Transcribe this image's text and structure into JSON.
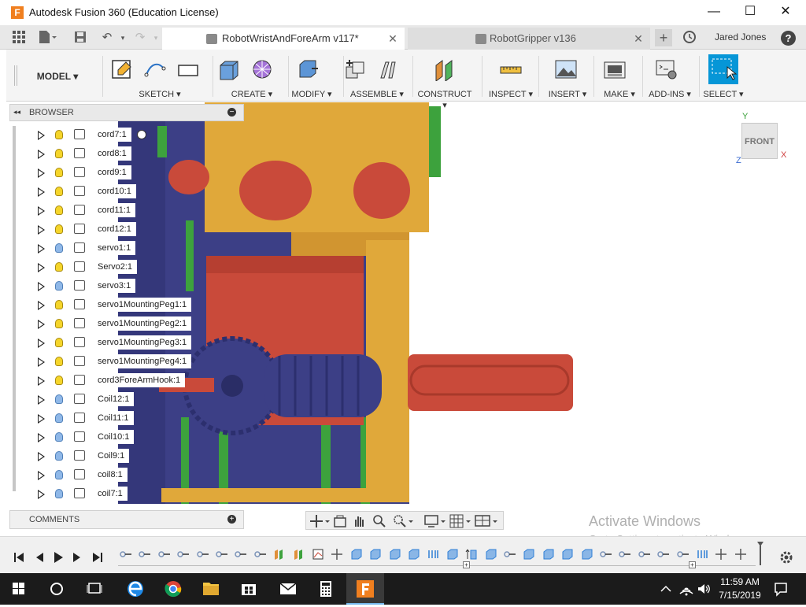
{
  "window": {
    "title": "Autodesk Fusion 360 (Education License)",
    "minimize_glyph": "—",
    "maximize_glyph": "☐",
    "close_glyph": "✕"
  },
  "tabs": [
    {
      "label": "RobotWristAndForeArm v117*",
      "active": true
    },
    {
      "label": "RobotGripper v136",
      "active": false
    }
  ],
  "tab_close_glyph": "✕",
  "new_tab_glyph": "+",
  "user": {
    "name": "Jared Jones"
  },
  "help_glyph": "?",
  "ribbon": {
    "workspace": "MODEL ▾",
    "groups": [
      {
        "label": "SKETCH ▾"
      },
      {
        "label": "CREATE ▾"
      },
      {
        "label": "MODIFY ▾"
      },
      {
        "label": "ASSEMBLE ▾"
      },
      {
        "label": "CONSTRUCT ▾"
      },
      {
        "label": "INSPECT ▾"
      },
      {
        "label": "INSERT ▾"
      },
      {
        "label": "MAKE ▾"
      },
      {
        "label": "ADD-INS ▾"
      },
      {
        "label": "SELECT ▾"
      }
    ]
  },
  "browser": {
    "title": "BROWSER",
    "collapse_glyph": "◂◂",
    "items": [
      {
        "label": "cord7:1",
        "bulb": "on"
      },
      {
        "label": "cord8:1",
        "bulb": "on"
      },
      {
        "label": "cord9:1",
        "bulb": "on"
      },
      {
        "label": "cord10:1",
        "bulb": "on"
      },
      {
        "label": "cord11:1",
        "bulb": "on"
      },
      {
        "label": "cord12:1",
        "bulb": "on"
      },
      {
        "label": "servo1:1",
        "bulb": "off"
      },
      {
        "label": "Servo2:1",
        "bulb": "on"
      },
      {
        "label": "servo3:1",
        "bulb": "off"
      },
      {
        "label": "servo1MountingPeg1:1",
        "bulb": "on"
      },
      {
        "label": "servo1MountingPeg2:1",
        "bulb": "on"
      },
      {
        "label": "servo1MountingPeg3:1",
        "bulb": "on"
      },
      {
        "label": "servo1MountingPeg4:1",
        "bulb": "on"
      },
      {
        "label": "cord3ForeArmHook:1",
        "bulb": "on"
      },
      {
        "label": "Coil12:1",
        "bulb": "off"
      },
      {
        "label": "Coil11:1",
        "bulb": "off"
      },
      {
        "label": "Coil10:1",
        "bulb": "off"
      },
      {
        "label": "Coil9:1",
        "bulb": "off"
      },
      {
        "label": "coil8:1",
        "bulb": "off"
      },
      {
        "label": "coil7:1",
        "bulb": "off"
      }
    ]
  },
  "comments": {
    "title": "COMMENTS",
    "add_glyph": "+"
  },
  "viewcube": {
    "face": "FRONT",
    "axis_y": "Y",
    "axis_x": "X",
    "axis_z": "Z"
  },
  "watermark": {
    "line1": "Activate Windows",
    "line2": "Go to Settings to activate Windows."
  },
  "clock": {
    "time": "11:59 AM",
    "date": "7/15/2019"
  },
  "colors": {
    "accent": "#0696d7",
    "bulb_on": "#f5d52a",
    "bulb_off": "#8fb8e8",
    "model_yellow": "#e0a83a",
    "model_red": "#c94a3a",
    "model_navy": "#3c3f86",
    "model_green": "#3da23d"
  }
}
